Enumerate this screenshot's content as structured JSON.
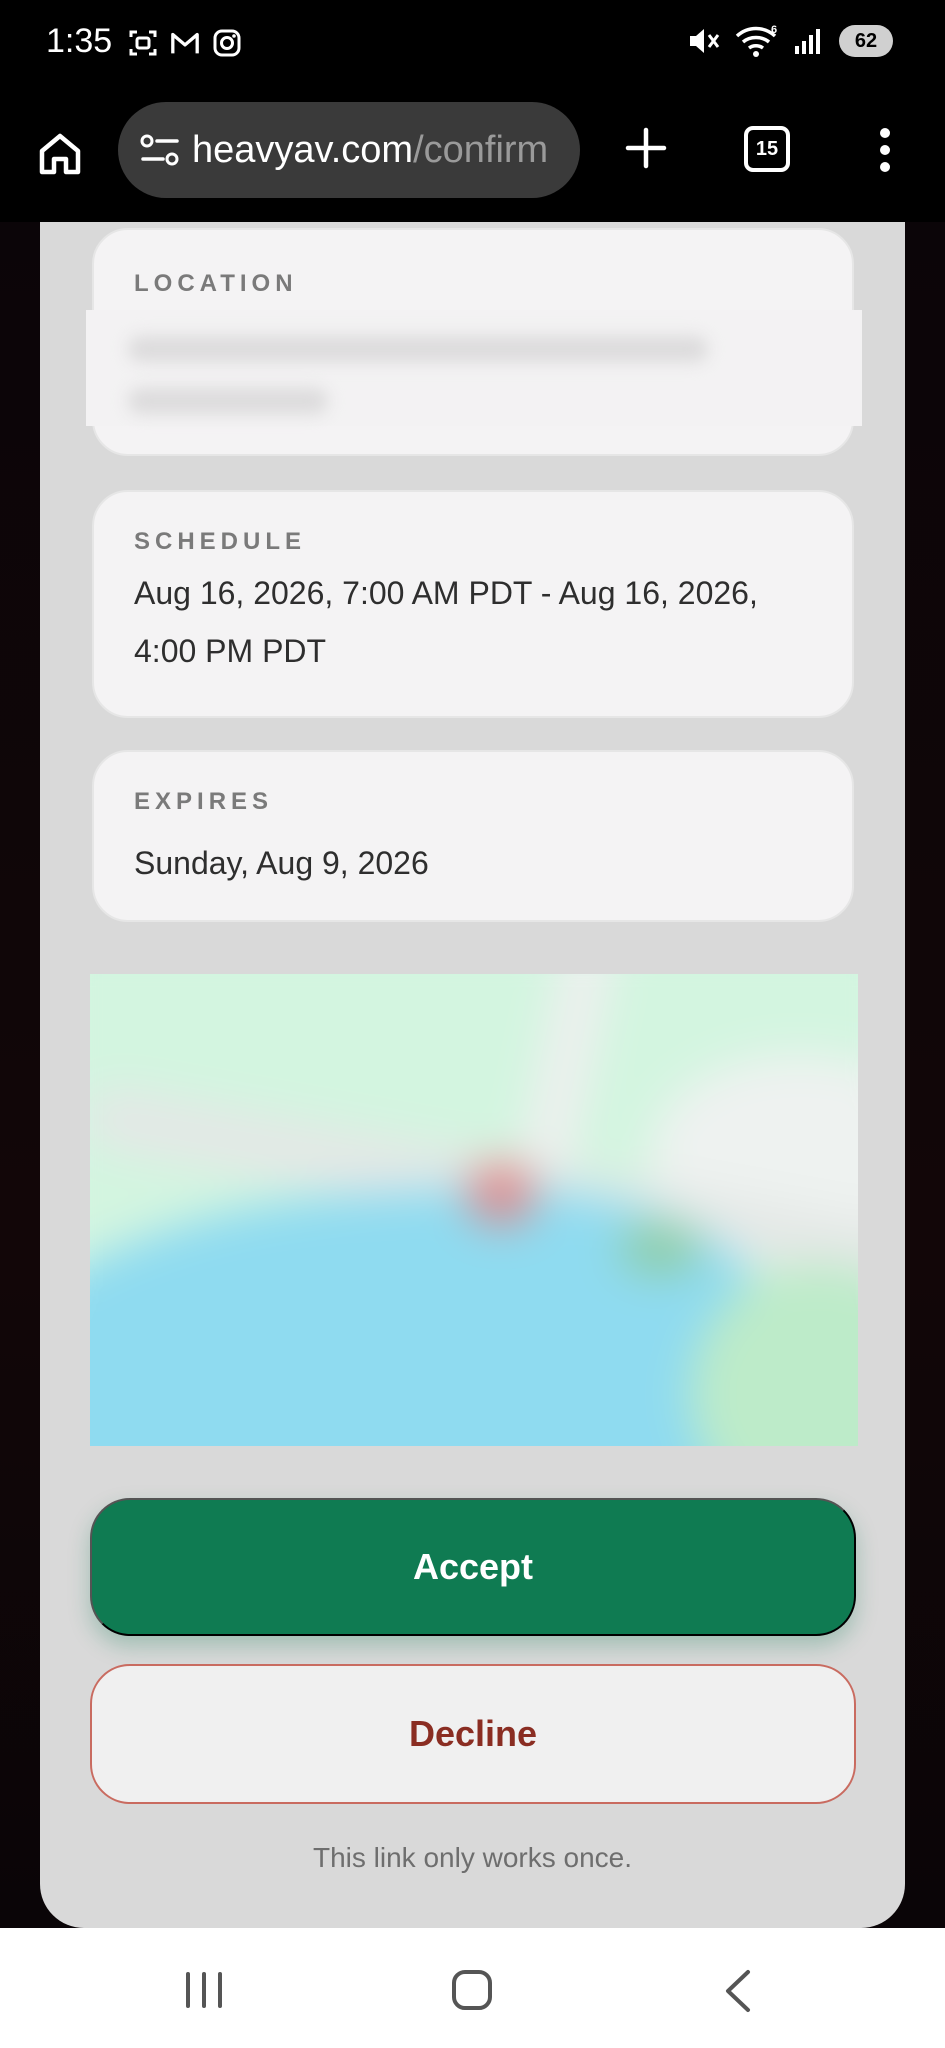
{
  "status_bar": {
    "time": "1:35",
    "left_icons": [
      "screen-record-icon",
      "gmail-icon",
      "instagram-icon"
    ],
    "right_icons": [
      "mute-icon",
      "wifi-icon",
      "signal-icon"
    ],
    "wifi_badge": "6",
    "battery": "62"
  },
  "browser": {
    "url_host": "heavyav.com",
    "url_path": "/confirm",
    "tab_count": "15"
  },
  "details": {
    "location": {
      "label": "LOCATION",
      "value": ""
    },
    "schedule": {
      "label": "SCHEDULE",
      "value": "Aug 16, 2026, 7:00 AM PDT - Aug 16, 2026, 4:00 PM PDT"
    },
    "expires": {
      "label": "EXPIRES",
      "value": "Sunday, Aug 9, 2026"
    }
  },
  "actions": {
    "accept_label": "Accept",
    "decline_label": "Decline",
    "footnote": "This link only works once."
  },
  "colors": {
    "accept_bg": "#0f7b52",
    "decline_text": "#8a2d22",
    "decline_border": "#c96b60",
    "sheet_bg": "#d9d9d9",
    "card_bg": "#f4f3f4"
  }
}
